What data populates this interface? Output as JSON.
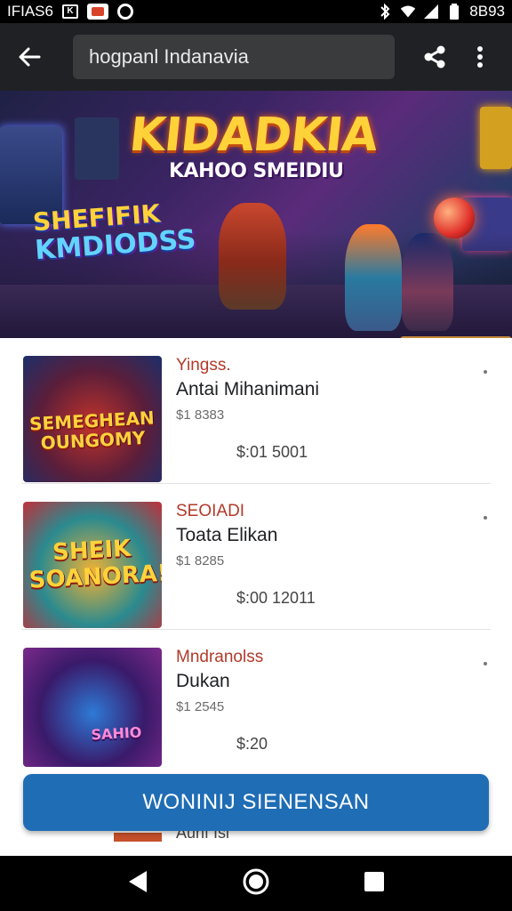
{
  "status_bar": {
    "left_text": "IFIAS6",
    "right_text": "8B93",
    "icons": [
      "app-box-icon",
      "mail-icon",
      "record-icon",
      "bluetooth-icon",
      "wifi-icon",
      "signal-icon",
      "battery-icon"
    ]
  },
  "app_bar": {
    "search_text": "hogpanl Indanavia",
    "icons": [
      "back-arrow-icon",
      "share-icon",
      "more-vert-icon"
    ]
  },
  "banner": {
    "title": "KIDADKIA",
    "subtitle": "KAHOO SMEIDIU",
    "logo_line1": "SHEFIFIK",
    "logo_line2": "KMDIODSS"
  },
  "items": [
    {
      "thumb_title": "SEMEGHEAN OUNGOMY",
      "category": "Yingss.",
      "name": "Antai Mihanimani",
      "price_small": "$1 8383",
      "price_main": "$:01 5001",
      "thumb_colors": [
        "#5b1e3a",
        "#c2332a",
        "#1c2f6a"
      ]
    },
    {
      "thumb_title": "SHEIK SOANORA!",
      "category": "SEOIADI",
      "name": "Toata Elikan",
      "price_small": "$1 8285",
      "price_main": "$:00 12011",
      "thumb_colors": [
        "#2a8a8f",
        "#f2b233",
        "#c0303a"
      ]
    },
    {
      "thumb_title": "SAHIO",
      "category": "Mndranolss",
      "name": "Dukan",
      "price_small": "$1 2545",
      "price_main": "$:20",
      "thumb_colors": [
        "#3a1a6a",
        "#2d7ad6",
        "#7a2a8a"
      ]
    }
  ],
  "cta": {
    "label": "WONINIJ SIENENSAN"
  },
  "peek_text": "Aunf Isi",
  "nav_icons": [
    "nav-back-icon",
    "nav-home-icon",
    "nav-recents-icon"
  ],
  "colors": {
    "appbar": "#202124",
    "cta": "#1f6db5",
    "category": "#b23a2a"
  }
}
